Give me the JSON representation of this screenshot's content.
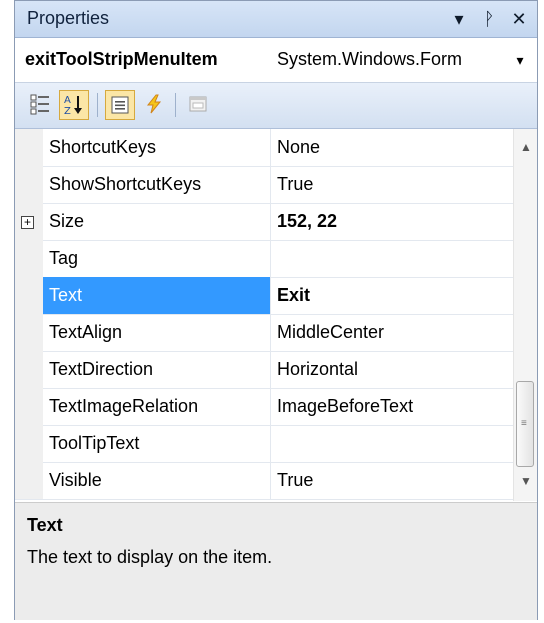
{
  "window": {
    "title": "Properties",
    "buttons": {
      "dropdown": "▾",
      "pin": "ᚹ",
      "close": "✕"
    }
  },
  "object_selector": {
    "name": "exitToolStripMenuItem",
    "type": "System.Windows.Form",
    "dropdown_icon": "▾"
  },
  "toolbar": {
    "categorized_icon": "categorized-icon",
    "alphabetical_icon": "alphabetical-icon",
    "properties_icon": "properties-icon",
    "events_icon": "events-icon",
    "property_pages_icon": "property-pages-icon",
    "active": "alphabetical"
  },
  "grid": {
    "rows": [
      {
        "name": "ShortcutKeys",
        "value": "None",
        "bold": false,
        "selected": false,
        "expandable": false
      },
      {
        "name": "ShowShortcutKeys",
        "value": "True",
        "bold": false,
        "selected": false,
        "expandable": false
      },
      {
        "name": "Size",
        "value": "152, 22",
        "bold": true,
        "selected": false,
        "expandable": true
      },
      {
        "name": "Tag",
        "value": "",
        "bold": false,
        "selected": false,
        "expandable": false
      },
      {
        "name": "Text",
        "value": "Exit",
        "bold": true,
        "selected": true,
        "expandable": false
      },
      {
        "name": "TextAlign",
        "value": "MiddleCenter",
        "bold": false,
        "selected": false,
        "expandable": false
      },
      {
        "name": "TextDirection",
        "value": "Horizontal",
        "bold": false,
        "selected": false,
        "expandable": false
      },
      {
        "name": "TextImageRelation",
        "value": "ImageBeforeText",
        "bold": false,
        "selected": false,
        "expandable": false
      },
      {
        "name": "ToolTipText",
        "value": "",
        "bold": false,
        "selected": false,
        "expandable": false
      },
      {
        "name": "Visible",
        "value": "True",
        "bold": false,
        "selected": false,
        "expandable": false
      }
    ],
    "expand_glyph": "+"
  },
  "description": {
    "title": "Text",
    "text": "The text to display on the item."
  },
  "colors": {
    "selection": "#3399ff",
    "titlebar": "#c3d6ef"
  }
}
